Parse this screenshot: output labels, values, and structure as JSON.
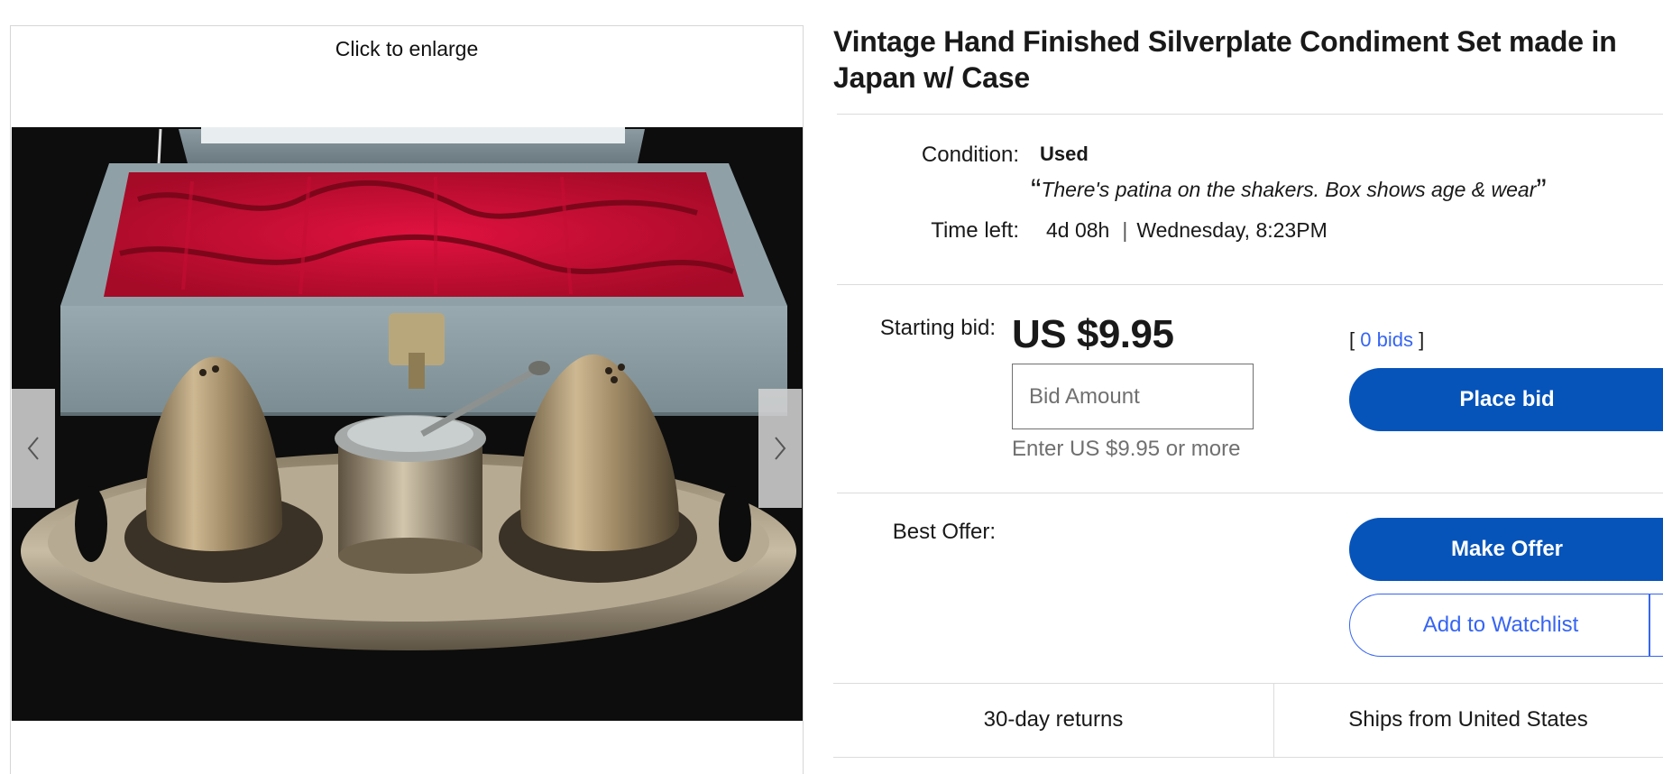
{
  "gallery": {
    "enlarge_label": "Click to enlarge",
    "prev_icon": "chevron-left-icon",
    "next_icon": "chevron-right-icon"
  },
  "item": {
    "title": "Vintage Hand Finished Silverplate Condiment Set made in Japan w/ Case"
  },
  "condition": {
    "label": "Condition:",
    "value": "Used",
    "note": "There's patina on the shakers. Box shows age & wear",
    "quote_open": "“",
    "quote_close": "”"
  },
  "time_left": {
    "label": "Time left:",
    "remaining": "4d 08h",
    "separator": "|",
    "end": "Wednesday, 8:23PM"
  },
  "bidding": {
    "label": "Starting bid:",
    "price": "US $9.95",
    "bid_placeholder": "Bid Amount",
    "hint": "Enter US $9.95 or more",
    "bids_open": "[",
    "bids_link": "0 bids",
    "bids_close": "]",
    "place_bid": "Place bid"
  },
  "offer": {
    "label": "Best Offer:",
    "make_offer": "Make Offer",
    "watchlist": "Add to Watchlist"
  },
  "footer": {
    "returns": "30-day returns",
    "ships_from": "Ships from United States"
  },
  "colors": {
    "primary_button": "#0654ba",
    "link": "#3665f3",
    "muted_text": "#707070",
    "divider": "#dcdcdc"
  }
}
